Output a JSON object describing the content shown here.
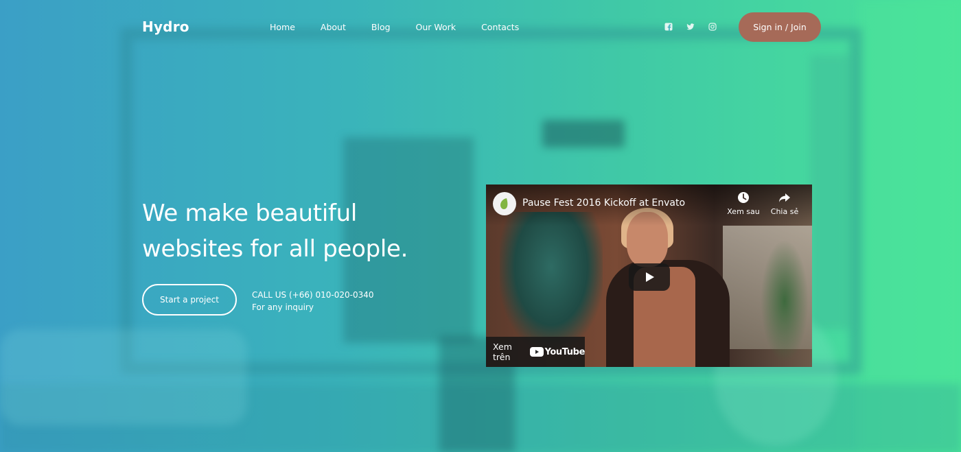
{
  "brand": {
    "name": "Hydro",
    "accent": "#a66a58"
  },
  "nav": {
    "items": [
      {
        "label": "Home"
      },
      {
        "label": "About"
      },
      {
        "label": "Blog"
      },
      {
        "label": "Our Work"
      },
      {
        "label": "Contacts"
      }
    ]
  },
  "social": {
    "icons": [
      "facebook-icon",
      "twitter-icon",
      "instagram-icon"
    ]
  },
  "header": {
    "signin_label": "Sign in / Join"
  },
  "hero": {
    "headline_line1": "We make beautiful",
    "headline_line2": "websites for all people.",
    "cta_label": "Start a project",
    "call_line1": "CALL US (+66) 010-020-0340",
    "call_line2": "For any inquiry"
  },
  "video": {
    "title": "Pause Fest 2016 Kickoff at Envato",
    "watch_later_label": "Xem sau",
    "share_label": "Chia sẻ",
    "watch_on_label": "Xem trên",
    "platform_label": "YouTube"
  }
}
